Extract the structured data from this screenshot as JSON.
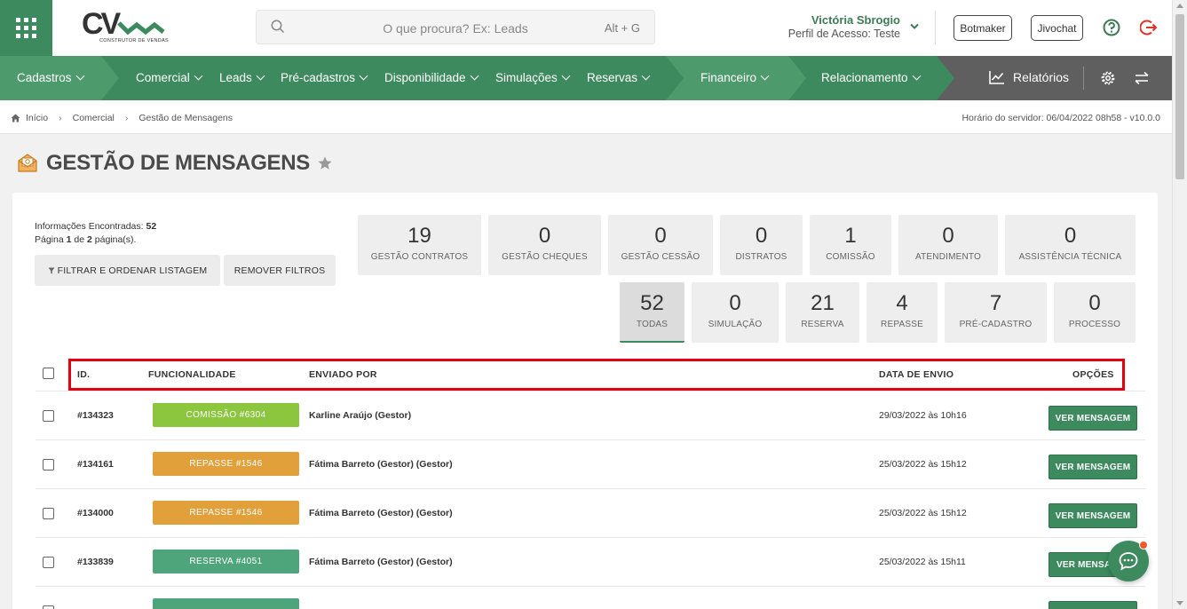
{
  "header": {
    "logo_text": "CV",
    "logo_subtitle": "CONSTRUTOR DE VENDAS",
    "search_placeholder": "O que procura? Ex: Leads",
    "search_shortcut": "Alt + G",
    "user_name": "Victória Sbrogio",
    "user_profile": "Perfil de Acesso: Teste",
    "botmaker_label": "Botmaker",
    "jivochat_label": "Jivochat"
  },
  "nav": {
    "items": [
      "Cadastros",
      "Comercial",
      "Leads",
      "Pré-cadastros",
      "Disponibilidade",
      "Simulações",
      "Reservas",
      "Financeiro",
      "Relacionamento"
    ],
    "reports_label": "Relatórios"
  },
  "breadcrumb": {
    "items": [
      "Início",
      "Comercial",
      "Gestão de Mensagens"
    ],
    "server_time": "Horário do servidor: 06/04/2022 08h58 - v10.0.0"
  },
  "page": {
    "title": "GESTÃO DE MENSAGENS",
    "info_label": "Informações Encontradas:",
    "info_count": "52",
    "page_prefix": "Página",
    "page_current": "1",
    "page_mid": "de",
    "page_total": "2",
    "page_suffix": "página(s).",
    "filter_label": "FILTRAR E ORDENAR LISTAGEM",
    "remove_filters_label": "REMOVER FILTROS"
  },
  "stats_top": [
    {
      "num": "19",
      "label": "GESTÃO CONTRATOS"
    },
    {
      "num": "0",
      "label": "GESTÃO CHEQUES"
    },
    {
      "num": "0",
      "label": "GESTÃO CESSÃO"
    },
    {
      "num": "0",
      "label": "DISTRATOS"
    },
    {
      "num": "1",
      "label": "COMISSÃO"
    },
    {
      "num": "0",
      "label": "ATENDIMENTO"
    },
    {
      "num": "0",
      "label": "ASSISTÊNCIA TÉCNICA"
    }
  ],
  "stats_bottom": [
    {
      "num": "52",
      "label": "TODAS"
    },
    {
      "num": "0",
      "label": "SIMULAÇÃO"
    },
    {
      "num": "21",
      "label": "RESERVA"
    },
    {
      "num": "4",
      "label": "REPASSE"
    },
    {
      "num": "7",
      "label": "PRÉ-CADASTRO"
    },
    {
      "num": "0",
      "label": "PROCESSO"
    }
  ],
  "table": {
    "headers": {
      "id": "ID.",
      "func": "FUNCIONALIDADE",
      "by": "ENVIADO POR",
      "date": "DATA DE ENVIO",
      "options": "OPÇÕES"
    },
    "rows": [
      {
        "id": "#134323",
        "tag": "COMISSÃO #6304",
        "tag_color": "#8cc63f",
        "by": "Karline Araújo (Gestor)",
        "date": "29/03/2022 às 10h16",
        "action": "VER MENSAGEM"
      },
      {
        "id": "#134161",
        "tag": "REPASSE #1546",
        "tag_color": "#e2a03a",
        "by": "Fátima Barreto (Gestor) (Gestor)",
        "date": "25/03/2022 às 15h12",
        "action": "VER MENSAGEM"
      },
      {
        "id": "#134000",
        "tag": "REPASSE #1546",
        "tag_color": "#e2a03a",
        "by": "Fátima Barreto (Gestor) (Gestor)",
        "date": "25/03/2022 às 15h12",
        "action": "VER MENSAGEM"
      },
      {
        "id": "#133839",
        "tag": "RESERVA #4051",
        "tag_color": "#4ea57c",
        "by": "Fátima Barreto (Gestor) (Gestor)",
        "date": "25/03/2022 às 15h11",
        "action": "VER MENSA"
      }
    ]
  }
}
